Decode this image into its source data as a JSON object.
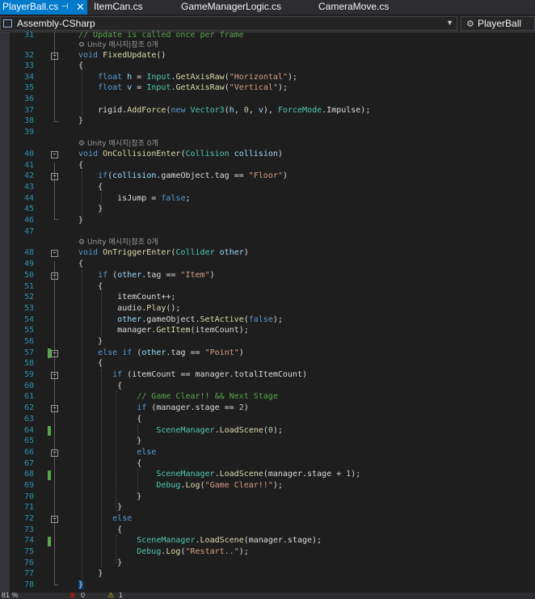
{
  "tabs": [
    {
      "label": "PlayerBall.cs",
      "active": true
    },
    {
      "label": "ItemCan.cs"
    },
    {
      "label": "GameManagerLogic.cs"
    },
    {
      "label": "CameraMove.cs"
    }
  ],
  "nav": {
    "project": "Assembly-CSharp",
    "member": "PlayerBall"
  },
  "editor": {
    "first_line": "// Update is called once per frame",
    "codelens": "Unity 메시지|참조 0개",
    "lines": [
      {
        "n": 31
      },
      {
        "n": 32
      },
      {
        "n": 33
      },
      {
        "n": 34
      },
      {
        "n": 35
      },
      {
        "n": 36
      },
      {
        "n": 37
      },
      {
        "n": 38
      },
      {
        "n": 39
      },
      {
        "n": 40
      },
      {
        "n": 41
      },
      {
        "n": 42
      },
      {
        "n": 43
      },
      {
        "n": 44
      },
      {
        "n": 45
      },
      {
        "n": 46
      },
      {
        "n": 47
      },
      {
        "n": 48
      },
      {
        "n": 49
      },
      {
        "n": 50
      },
      {
        "n": 51
      },
      {
        "n": 52
      },
      {
        "n": 53
      },
      {
        "n": 54
      },
      {
        "n": 55
      },
      {
        "n": 56
      },
      {
        "n": 57
      },
      {
        "n": 58
      },
      {
        "n": 59
      },
      {
        "n": 60
      },
      {
        "n": 61
      },
      {
        "n": 62
      },
      {
        "n": 63
      },
      {
        "n": 64
      },
      {
        "n": 65
      },
      {
        "n": 66
      },
      {
        "n": 67
      },
      {
        "n": 68
      },
      {
        "n": 69
      },
      {
        "n": 70
      },
      {
        "n": 71
      },
      {
        "n": 72
      },
      {
        "n": 73
      },
      {
        "n": 74
      },
      {
        "n": 75
      },
      {
        "n": 76
      },
      {
        "n": 77
      },
      {
        "n": 78
      }
    ]
  },
  "status": {
    "zoom": "81 %",
    "errors": "0",
    "warnings": "1"
  },
  "colors": {
    "accent": "#007acc",
    "keyword": "#569cd6",
    "type": "#4ec9b0",
    "string": "#d69d85",
    "comment": "#57a64a",
    "method": "#dcdcaa",
    "line_number": "#2b91af"
  }
}
